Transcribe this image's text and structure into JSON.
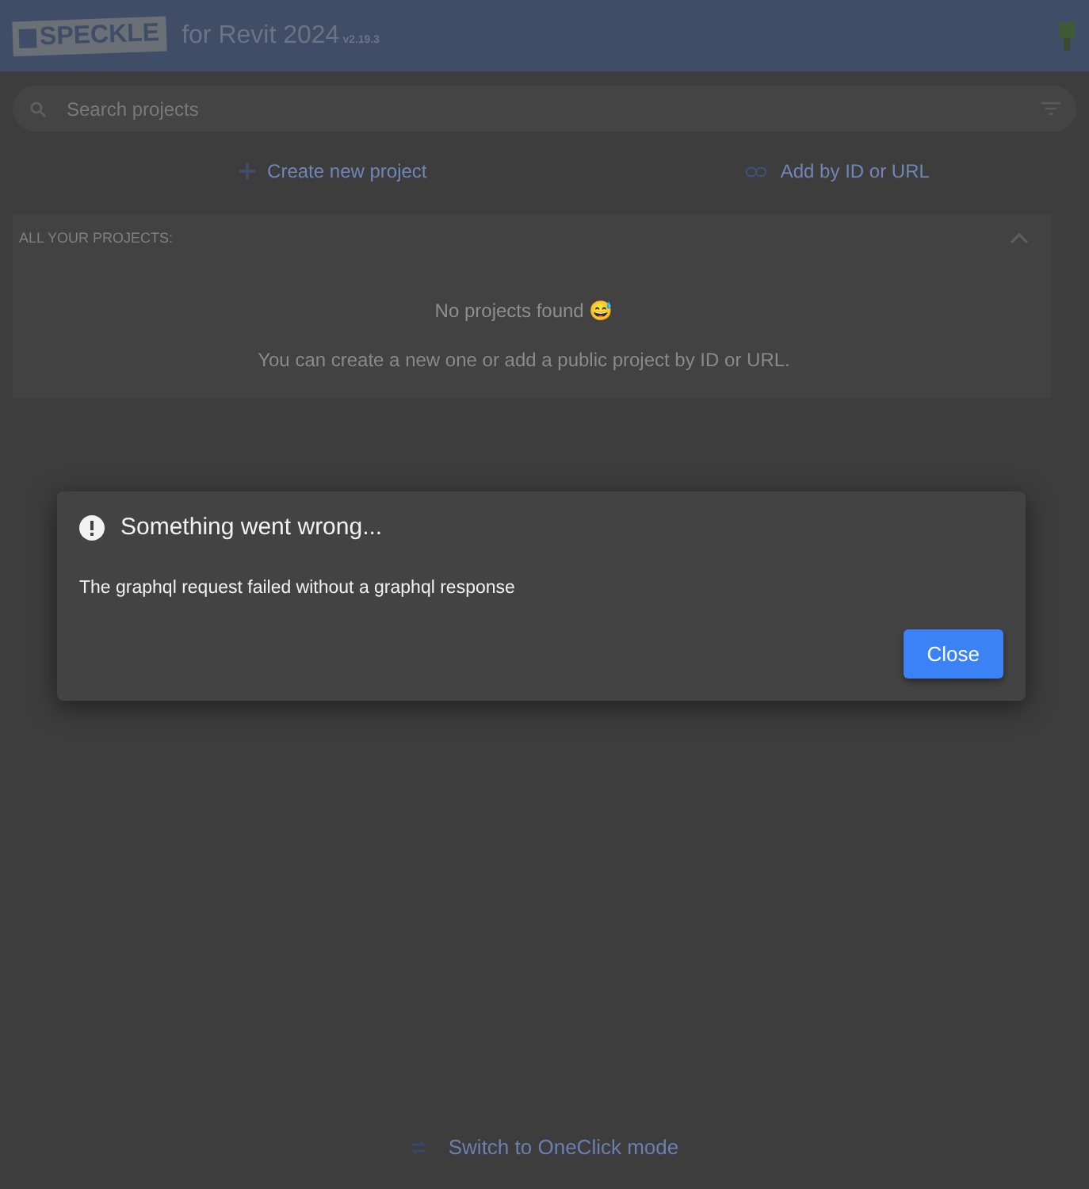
{
  "header": {
    "logo": "SPECKLE",
    "title": "for Revit 2024",
    "version": "v2.19.3"
  },
  "search": {
    "placeholder": "Search projects"
  },
  "actions": [
    {
      "kind": "create",
      "label": "Create new project"
    },
    {
      "kind": "link",
      "label": "Add by ID or URL"
    }
  ],
  "projects": {
    "heading": "ALL YOUR PROJECTS:",
    "expanded": true,
    "empty_title": "No projects found 😅",
    "empty_text": "You can create a new one or add a public project by ID or URL."
  },
  "dialog": {
    "title": "Something went wrong...",
    "message": "The graphql request failed without a graphql response",
    "buttons": [
      "Close"
    ]
  },
  "footer": {
    "label": "Switch to OneClick mode"
  }
}
